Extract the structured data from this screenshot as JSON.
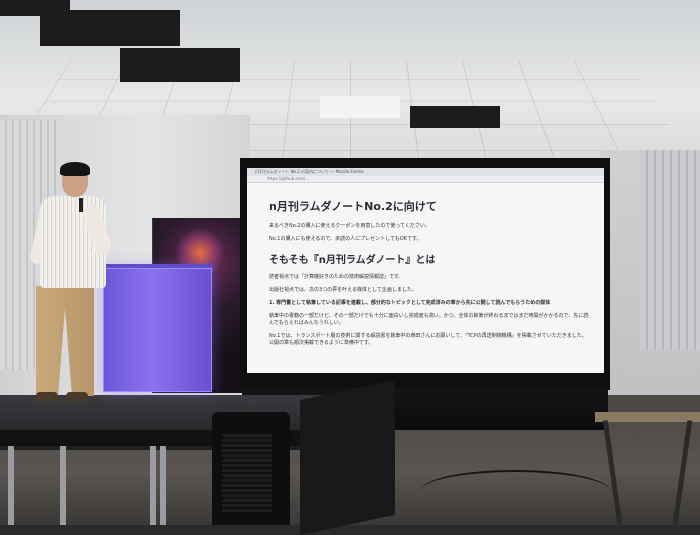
{
  "slide": {
    "browser_tabs": "n月刊ラムダノート No.2 の案内について — Mozilla Firefox",
    "url": "https://github.com/...",
    "heading1": "n月刊ラムダノートNo.2に向けて",
    "para1": "来るべきNo.2の購入に使えるクーポンを用意したので使ってください。",
    "para2": "No.1の購入にも使えるので、未読の人にプレゼントしてもOKです。",
    "heading2": "そもそも『n月刊ラムダノート』とは",
    "para3": "読者視点では「計算機好きのための技術解説情報誌」です。",
    "para4": "出版社視点では、次の3つの夢を叶える媒体として企画しました。",
    "para5": "1. 専門書として執筆している記事を連載し、部分的なトピックとして完成済みの章から先に公開して読んでもらうための媒体",
    "para6": "執筆中の書籍の一部だけど、その一部だけでも十分に面白いし完成度も高い。かつ、全体の執筆が終わるまではまだ時間がかかるので、先に読んでもらえればみんなうれしい。",
    "para7": "No.1では、トランスポート層の技術に関する解説書を執筆中の西田さんにお願いして、『TCPの再送制御機構』を掲載させていただきました。公開の章も順次掲載できるように準備中です。"
  },
  "colors": {
    "podium": "#7b63e6",
    "screen_bg": "#f5f6f8"
  }
}
